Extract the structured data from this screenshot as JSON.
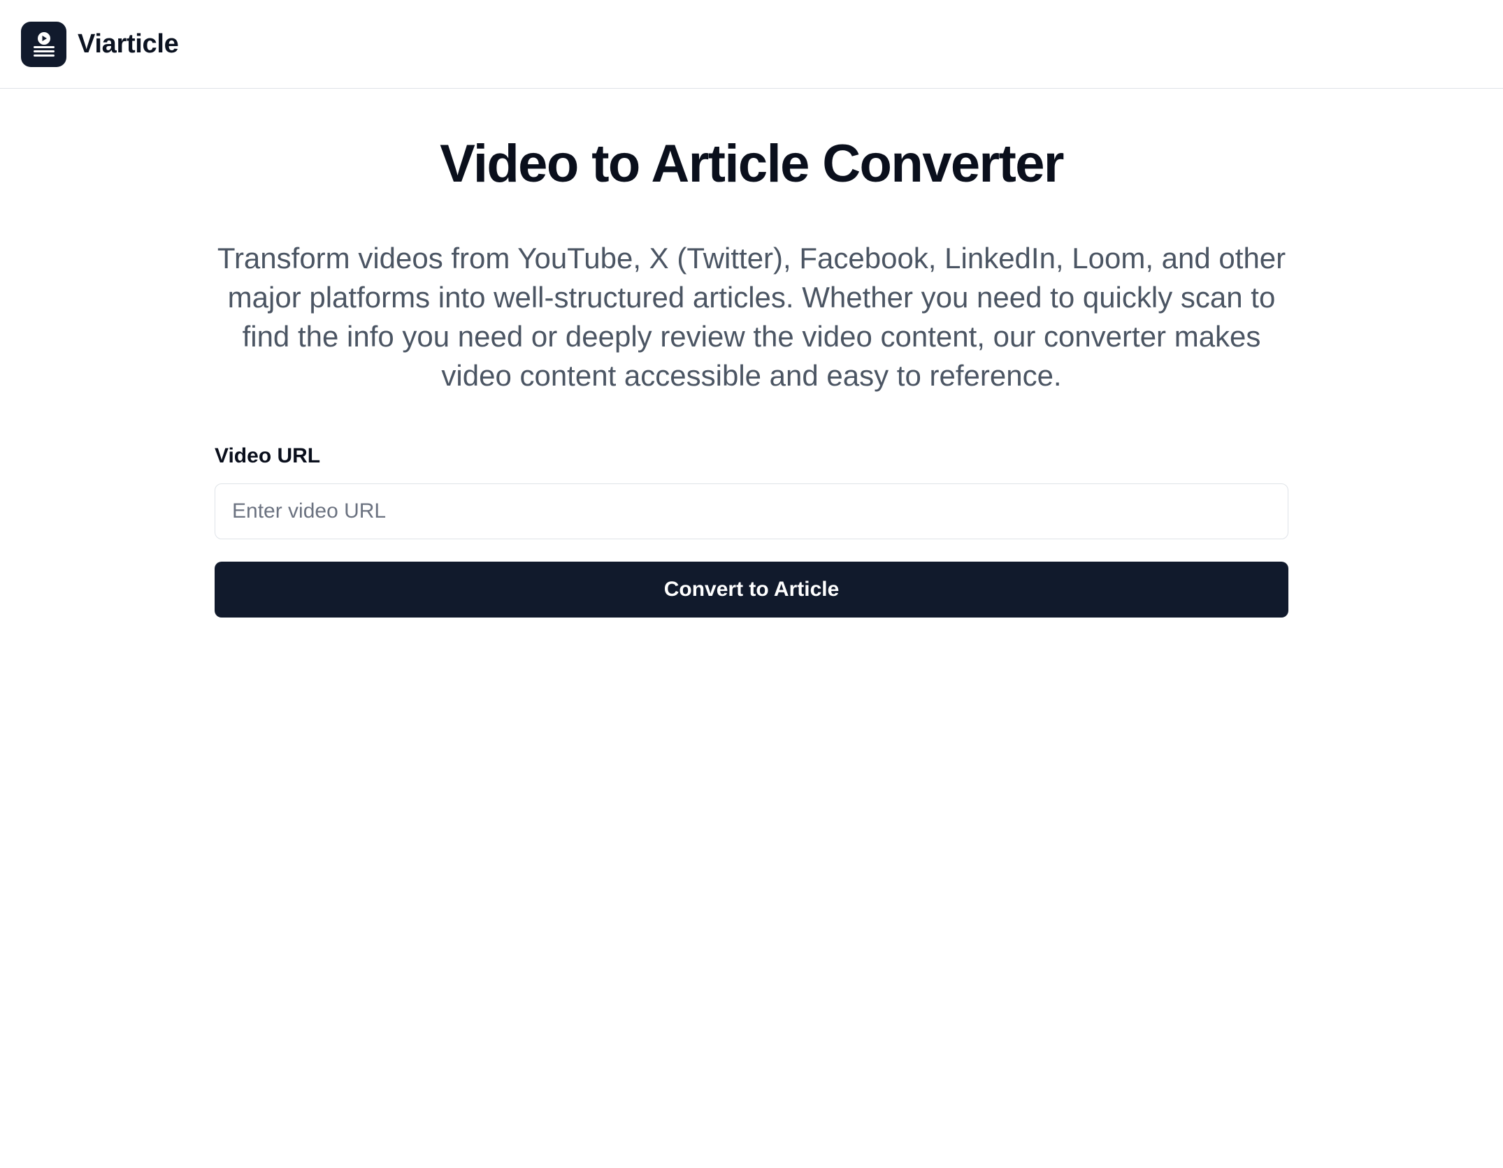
{
  "header": {
    "brand": "Viarticle",
    "logo_icon": "video-article-icon"
  },
  "main": {
    "title": "Video to Article Converter",
    "description": "Transform videos from YouTube, X (Twitter), Facebook, LinkedIn, Loom, and other major platforms into well-structured articles. Whether you need to quickly scan to find the info you need or deeply review the video content, our converter makes video content accessible and easy to reference."
  },
  "form": {
    "label": "Video URL",
    "input_value": "",
    "input_placeholder": "Enter video URL",
    "button_label": "Convert to Article"
  },
  "colors": {
    "primary": "#111a2c",
    "muted_text": "#4b5563",
    "border": "#dfe3e8"
  }
}
